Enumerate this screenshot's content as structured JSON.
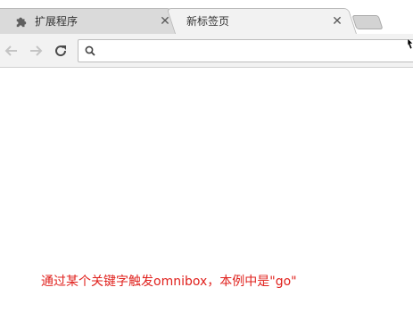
{
  "tabs": [
    {
      "title": "扩展程序",
      "icon": "puzzle-piece-icon",
      "close_label": "✕",
      "active": false
    },
    {
      "title": "新标签页",
      "close_label": "✕",
      "active": true
    }
  ],
  "toolbar": {
    "back_icon": "arrow-left-icon",
    "forward_icon": "arrow-right-icon",
    "reload_icon": "reload-icon"
  },
  "omnibox": {
    "value": "",
    "placeholder": "",
    "icon": "search-icon"
  },
  "caption": "通过某个关键字触发omnibox，本例中是\"go\"",
  "colors": {
    "caption": "#e0211d",
    "tab_active": "#f2f2f2",
    "tab_inactive": "#dadada"
  }
}
